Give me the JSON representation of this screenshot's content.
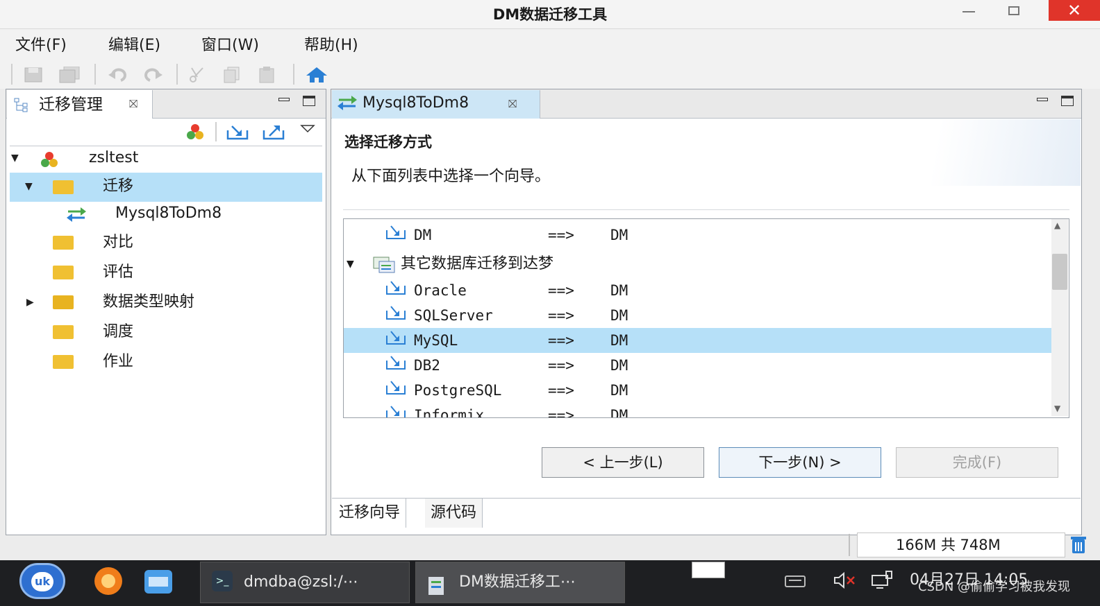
{
  "window": {
    "title": "DM数据迁移工具"
  },
  "menu": [
    "文件(F)",
    "编辑(E)",
    "窗口(W)",
    "帮助(H)"
  ],
  "left_panel": {
    "tab_label": "迁移管理",
    "tree": {
      "root": "zsltest",
      "migration_folder": "迁移",
      "migration_item": "Mysql8ToDm8",
      "folders": [
        "对比",
        "评估",
        "数据类型映射",
        "调度",
        "作业"
      ]
    }
  },
  "editor": {
    "tab_label": "Mysql8ToDm8",
    "wizard_title": "选择迁移方式",
    "wizard_desc": "从下面列表中选择一个向导。",
    "list": {
      "top_row": {
        "source": "DM",
        "arrow": "==>",
        "target": "DM"
      },
      "group_label": "其它数据库迁移到达梦",
      "rows": [
        {
          "source": "Oracle",
          "arrow": "==>",
          "target": "DM"
        },
        {
          "source": "SQLServer",
          "arrow": "==>",
          "target": "DM"
        },
        {
          "source": "MySQL",
          "arrow": "==>",
          "target": "DM"
        },
        {
          "source": "DB2",
          "arrow": "==>",
          "target": "DM"
        },
        {
          "source": "PostgreSQL",
          "arrow": "==>",
          "target": "DM"
        },
        {
          "source": "Informix",
          "arrow": "==>",
          "target": "DM"
        }
      ],
      "selected": "MySQL"
    },
    "buttons": {
      "back": "< 上一步(L)",
      "next": "下一步(N) >",
      "finish": "完成(F)"
    },
    "bottom_tabs": [
      "迁移向导",
      "源代码"
    ]
  },
  "status": {
    "memory": "166M 共 748M"
  },
  "taskbar": {
    "tasks": [
      "dmdba@zsl:/⋯",
      "DM数据迁移工⋯"
    ],
    "clock": "04月27日 14:05",
    "watermark": "CSDN @偷偷学习被我发现"
  },
  "colors": {
    "selection": "#b6e0f8",
    "folder": "#e8b320",
    "close": "#e0342a",
    "taskbar": "#1e1f22"
  }
}
